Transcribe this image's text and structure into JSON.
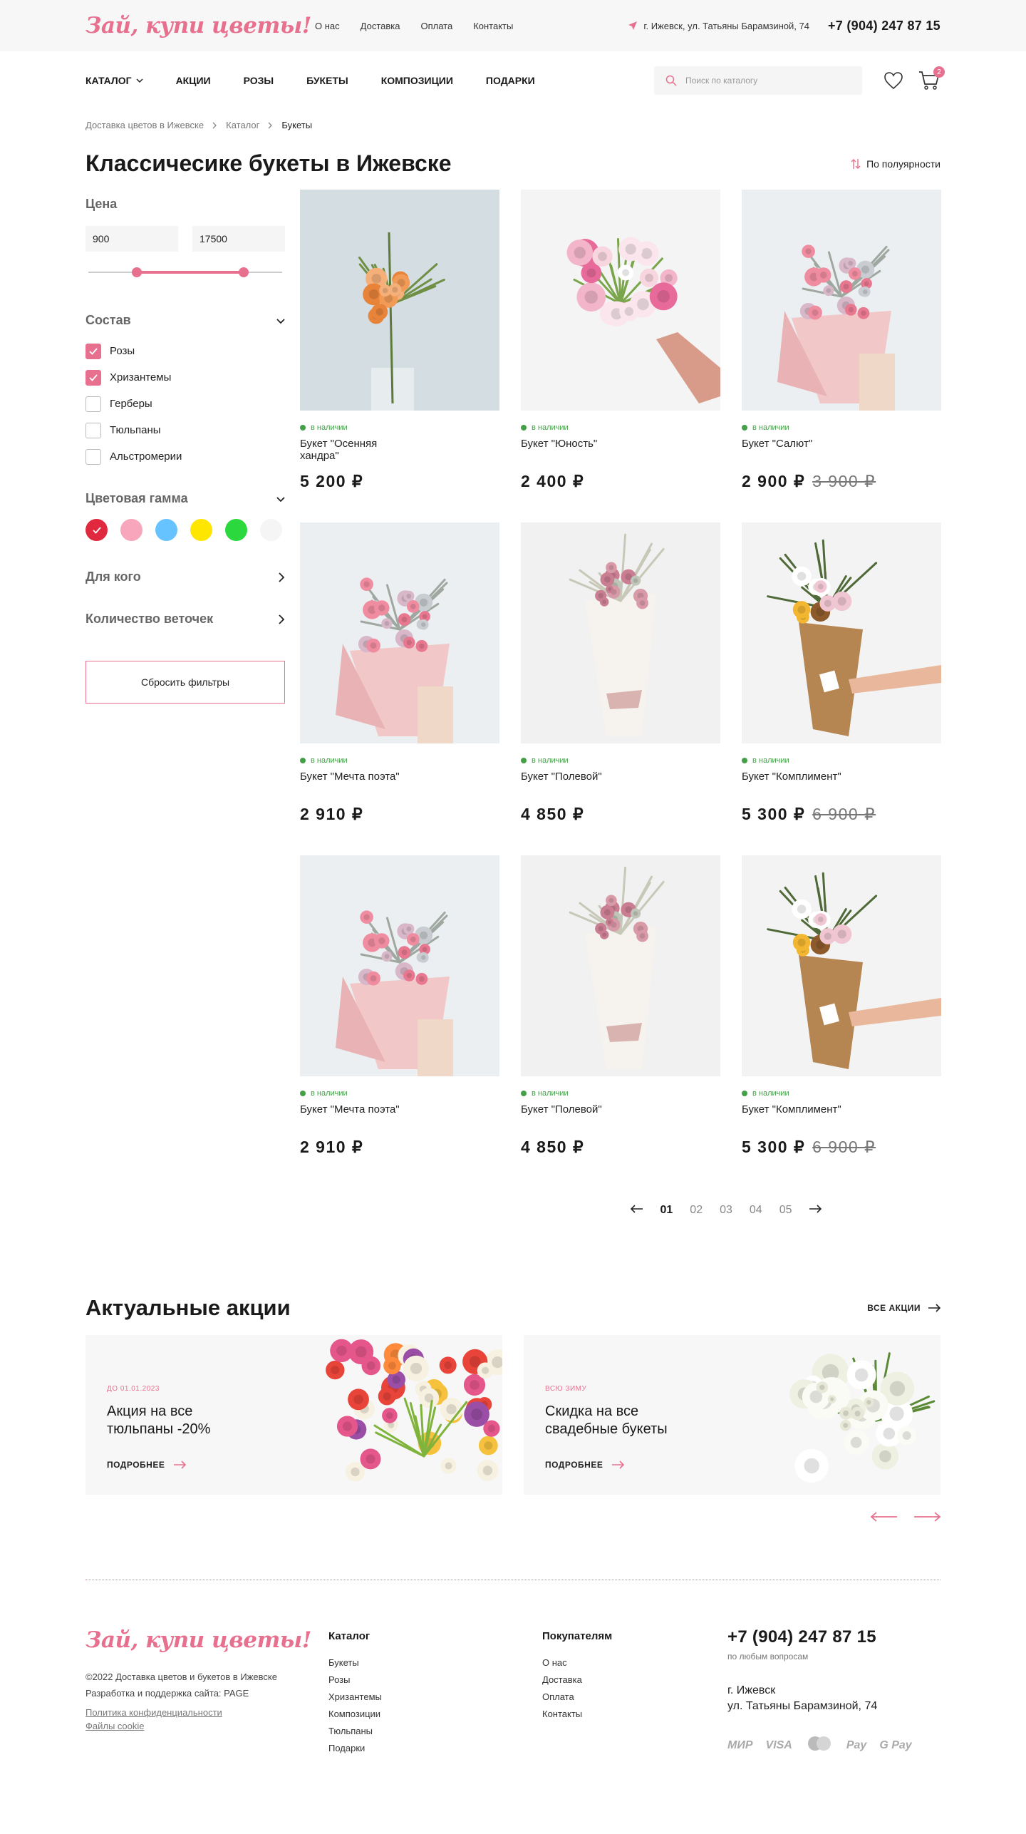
{
  "header": {
    "logo": "Зай, купи цветы!",
    "links": [
      "О нас",
      "Доставка",
      "Оплата",
      "Контакты"
    ],
    "address": "г. Ижевск, ул. Татьяны Барамзиной, 74",
    "phone": "+7 (904) 247 87 15"
  },
  "nav": {
    "items": [
      "КАТАЛОГ",
      "АКЦИИ",
      "РОЗЫ",
      "БУКЕТЫ",
      "КОМПОЗИЦИИ",
      "ПОДАРКИ"
    ],
    "search_placeholder": "Поиск по каталогу",
    "cart_count": "2"
  },
  "breadcrumb": [
    "Доставка цветов в Ижевске",
    "Каталог",
    "Букеты"
  ],
  "page": {
    "title": "Классичесике букеты в Ижевске",
    "sort_label": "По полуярности"
  },
  "filters": {
    "price_title": "Цена",
    "price_from": "900",
    "price_to": "17500",
    "price_range_fraction": [
      0.25,
      0.8
    ],
    "composition_title": "Состав",
    "composition": [
      {
        "label": "Розы",
        "checked": true
      },
      {
        "label": "Хризантемы",
        "checked": true
      },
      {
        "label": "Герберы",
        "checked": false
      },
      {
        "label": "Тюльпаны",
        "checked": false
      },
      {
        "label": "Альстромерии",
        "checked": false
      }
    ],
    "color_title": "Цветовая гамма",
    "colors": [
      "#e0283f",
      "#f7a6bb",
      "#67c3ff",
      "#ffe600",
      "#2bd93f",
      "#f5f5f5"
    ],
    "for_whom_title": "Для кого",
    "branches_title": "Количество веточек",
    "reset_label": "Сбросить фильтры"
  },
  "products": [
    {
      "status": "в наличии",
      "name": "Букет \"Осенняя хандра\"",
      "price": "5 200 ₽",
      "old_price": "",
      "photo": "autumn"
    },
    {
      "status": "в наличии",
      "name": "Букет \"Юность\"",
      "price": "2 400 ₽",
      "old_price": "",
      "photo": "youth"
    },
    {
      "status": "в наличии",
      "name": "Букет \"Салют\"",
      "price": "2 900 ₽",
      "old_price": "3 900 ₽",
      "photo": "pink"
    },
    {
      "status": "в наличии",
      "name": "Букет \"Мечта поэта\"",
      "price": "2 910 ₽",
      "old_price": "",
      "photo": "pink"
    },
    {
      "status": "в наличии",
      "name": "Букет \"Полевой\"",
      "price": "4 850 ₽",
      "old_price": "",
      "photo": "white"
    },
    {
      "status": "в наличии",
      "name": "Букет \"Комплимент\"",
      "price": "5 300 ₽",
      "old_price": "6 900 ₽",
      "photo": "craft"
    },
    {
      "status": "в наличии",
      "name": "Букет \"Мечта поэта\"",
      "price": "2 910 ₽",
      "old_price": "",
      "photo": "pink"
    },
    {
      "status": "в наличии",
      "name": "Букет \"Полевой\"",
      "price": "4 850 ₽",
      "old_price": "",
      "photo": "white"
    },
    {
      "status": "в наличии",
      "name": "Букет \"Комплимент\"",
      "price": "5 300 ₽",
      "old_price": "6 900 ₽",
      "photo": "craft"
    }
  ],
  "pagination": {
    "pages": [
      "01",
      "02",
      "03",
      "04",
      "05"
    ],
    "active": "01"
  },
  "promos": {
    "title": "Актуальные акции",
    "all_label": "ВСЕ АКЦИИ",
    "items": [
      {
        "tag": "ДО 01.01.2023",
        "title": "Акция на все тюльпаны -20%",
        "more": "ПОДРОБНЕЕ",
        "photo": "tulips"
      },
      {
        "tag": "ВСЮ ЗИМУ",
        "title": "Скидка на все свадебные букеты",
        "more": "ПОДРОБНЕЕ",
        "photo": "callas"
      }
    ]
  },
  "footer": {
    "logo": "Зай, купи цветы!",
    "copyright": "©2022 Доставка цветов и букетов в Ижевске",
    "dev": "Разработка и поддержка сайта: PAGE",
    "privacy": "Политика конфиденциальности",
    "cookies": "Файлы cookie",
    "catalog_title": "Каталог",
    "catalog_links": [
      "Букеты",
      "Розы",
      "Хризантемы",
      "Композиции",
      "Тюльпаны",
      "Подарки"
    ],
    "buyers_title": "Покупателям",
    "buyers_links": [
      "О нас",
      "Доставка",
      "Оплата",
      "Контакты"
    ],
    "phone": "+7 (904) 247 87 15",
    "phone_note": "по любым вопросам",
    "city": "г. Ижевск",
    "street": "ул. Татьяны Барамзиной, 74",
    "payments": [
      "МИР",
      "VISA",
      "",
      " Pay",
      "G Pay"
    ]
  }
}
